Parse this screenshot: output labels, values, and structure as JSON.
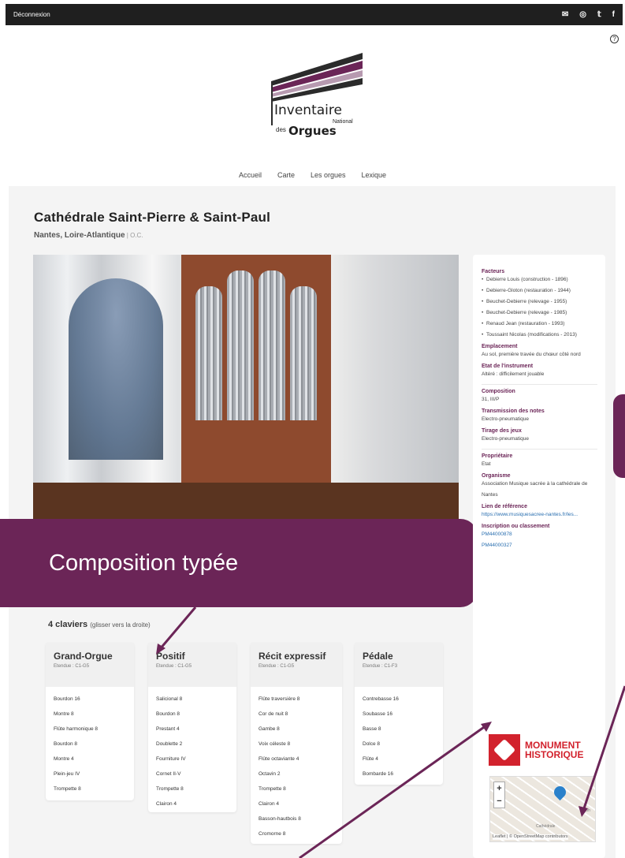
{
  "topbar": {
    "logout": "Déconnexion",
    "icons": [
      "mail-icon",
      "instagram-icon",
      "twitter-icon",
      "facebook-icon"
    ]
  },
  "help_icon": "?",
  "logo": {
    "line1": "Inventaire",
    "line2": "National",
    "line3_small": "des",
    "line3": "Orgues"
  },
  "nav": {
    "items": [
      "Accueil",
      "Carte",
      "Les orgues",
      "Lexique"
    ]
  },
  "header": {
    "title": "Cathédrale Saint-Pierre & Saint-Paul",
    "location": "Nantes, Loire-Atlantique",
    "separator": " | ",
    "classification": "O.C."
  },
  "callout": {
    "text": "Composition typée"
  },
  "claviers": {
    "heading": "4 claviers",
    "hint": "(glisser vers la droite)"
  },
  "keyboards": [
    {
      "name": "Grand-Orgue",
      "extent": "Etendue : C1-G5",
      "stops": [
        "Bourdon 16",
        "Montre 8",
        "Flûte harmonique 8",
        "Bourdon 8",
        "Montre 4",
        "Plein-jeu IV",
        "Trompette 8"
      ]
    },
    {
      "name": "Positif",
      "extent": "Etendue : C1-G5",
      "stops": [
        "Salicional 8",
        "Bourdon 8",
        "Prestant 4",
        "Doublette 2",
        "Fourniture IV",
        "Cornet II-V",
        "Trompette 8",
        "Clairon 4"
      ]
    },
    {
      "name": "Récit expressif",
      "extent": "Etendue : C1-G5",
      "stops": [
        "Flûte traversière 8",
        "Cor de nuit 8",
        "Gambe 8",
        "Voix céleste 8",
        "Flûte octaviante 4",
        "Octavin 2",
        "Trompette 8",
        "Clairon 4",
        "Basson-hautbois 8",
        "Cromorne 8"
      ]
    },
    {
      "name": "Pédale",
      "extent": "Etendue : C1-F3",
      "stops": [
        "Contrebasse 16",
        "Soubasse 16",
        "Basse 8",
        "Dolce 8",
        "Flûte 4",
        "Bombarde 16"
      ]
    }
  ],
  "sidebar": {
    "facteurs_label": "Facteurs",
    "facteurs": [
      "Debierre Louis (construction - 1896)",
      "Debierre-Gloton (restauration - 1944)",
      "Beuchet-Debierre (relevage - 1955)",
      "Beuchet-Debierre (relevage - 1985)",
      "Renaud Jean (restauration - 1993)",
      "Toussaint Nicolas (modifications - 2013)"
    ],
    "emplacement_label": "Emplacement",
    "emplacement": "Au sol, première travée du chœur côté nord",
    "etat_label": "Etat de l'instrument",
    "etat": "Altéré : difficilement jouable",
    "composition_label": "Composition",
    "composition": "31, III/P",
    "transmission_label": "Transmission des notes",
    "transmission": "Electro-pneumatique",
    "tirage_label": "Tirage des jeux",
    "tirage": "Electro-pneumatique",
    "proprietaire_label": "Propriétaire",
    "proprietaire": "Etat",
    "organisme_label": "Organisme",
    "organisme": "Association Musique sacrée à la cathédrale de Nantes",
    "lien_label": "Lien de référence",
    "lien": "https://www.musiquesacree-nantes.fr/les...",
    "inscription_label": "Inscription ou classement",
    "inscriptions": [
      "PM44000878",
      "PM44000327"
    ]
  },
  "monument": {
    "line1": "MONUMENT",
    "line2": "HISTORIQUE"
  },
  "map": {
    "zoom_in": "+",
    "zoom_out": "−",
    "label1": "Cathédrale",
    "label2": "Poh",
    "attribution": "Leaflet | © OpenStreetMap contributors"
  }
}
